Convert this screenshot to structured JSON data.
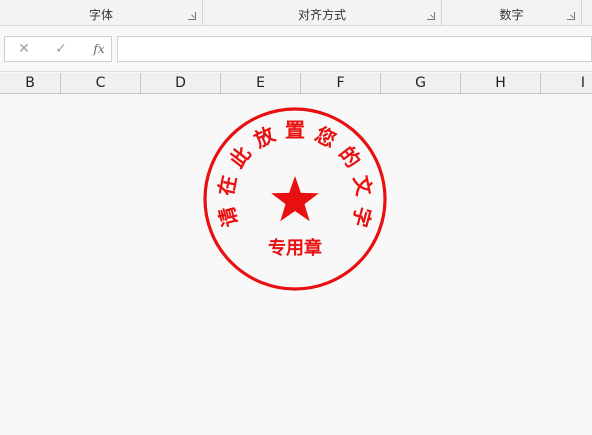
{
  "ribbon": {
    "groups": [
      {
        "label": "字体"
      },
      {
        "label": "对齐方式"
      },
      {
        "label": "数字"
      }
    ]
  },
  "formula_bar": {
    "cancel_icon": "close-icon",
    "enter_icon": "check-icon",
    "function_label": "fx",
    "value": ""
  },
  "columns": [
    "B",
    "C",
    "D",
    "E",
    "F",
    "G",
    "H",
    "I"
  ],
  "stamp": {
    "arc_text": "请在此放置您的文字",
    "center_text": "专用章",
    "color": "#e81010"
  }
}
